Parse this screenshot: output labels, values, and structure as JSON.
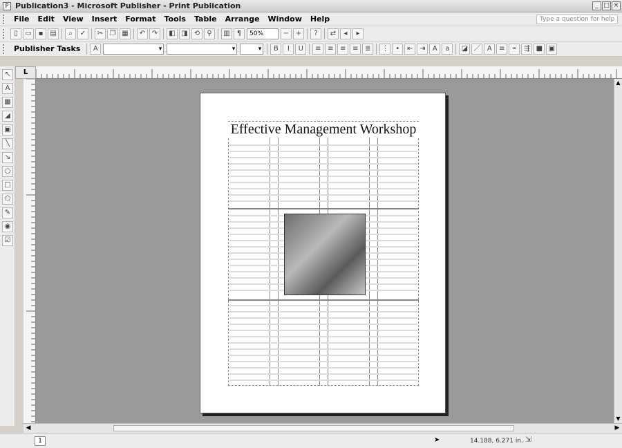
{
  "window": {
    "title": "Publication3 - Microsoft Publisher - Print Publication",
    "controls": [
      "_",
      "□",
      "×"
    ]
  },
  "menu": {
    "items": [
      "File",
      "Edit",
      "View",
      "Insert",
      "Format",
      "Tools",
      "Table",
      "Arrange",
      "Window",
      "Help"
    ],
    "help_placeholder": "Type a question for help"
  },
  "toolbar": {
    "zoom": "50%",
    "publisher_tasks": "Publisher Tasks"
  },
  "document": {
    "title": "Effective Management Workshop"
  },
  "ruler": {
    "corner": "L"
  },
  "status": {
    "page_number": "1",
    "coordinates": "14.188, 6.271 in."
  }
}
